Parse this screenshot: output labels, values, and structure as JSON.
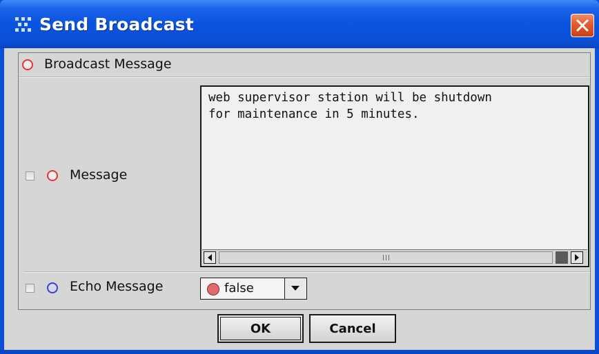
{
  "window": {
    "title": "Send Broadcast",
    "icons": {
      "app": "dots-grid-icon",
      "close": "close-icon"
    },
    "close_color": "#e25a2e",
    "titlebar_color": "#0a54e0"
  },
  "section": {
    "header_label": "Broadcast Message",
    "header_icon": "red-circle-icon"
  },
  "fields": {
    "message": {
      "label": "Message",
      "checked": false,
      "value": "web supervisor station will be shutdown\nfor maintenance in 5 minutes."
    },
    "echo": {
      "label": "Echo Message",
      "checked": false,
      "selected_value": "false"
    }
  },
  "buttons": {
    "ok": "OK",
    "cancel": "Cancel"
  }
}
